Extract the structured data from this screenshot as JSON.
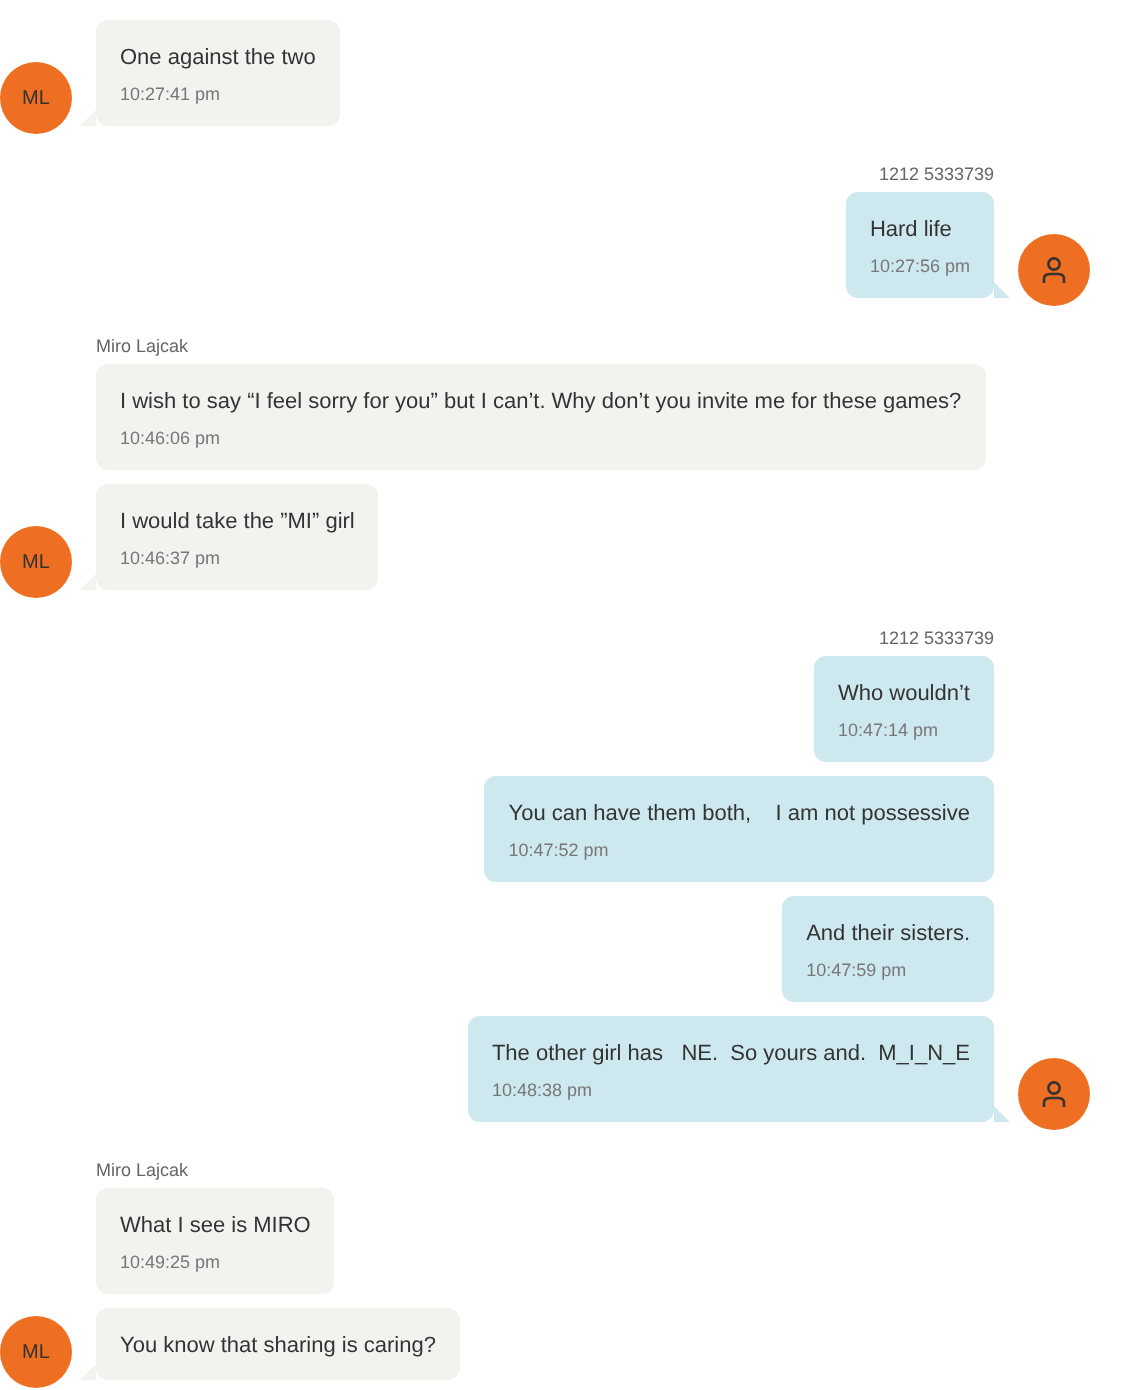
{
  "groups": [
    {
      "outgoing": false,
      "avatar": {
        "kind": "initials",
        "text": "ML"
      },
      "messages": [
        {
          "text": "One against the two",
          "time": "10:27:41 pm"
        }
      ]
    },
    {
      "outgoing": true,
      "sender": "1212 5333739",
      "avatar": {
        "kind": "person"
      },
      "messages": [
        {
          "text": "Hard life",
          "time": "10:27:56 pm"
        }
      ]
    },
    {
      "outgoing": false,
      "sender": "Miro Lajcak",
      "avatar": {
        "kind": "initials",
        "text": "ML"
      },
      "messages": [
        {
          "text": "I wish to say “I feel sorry for you” but I can’t. Why don’t you invite me for these games?",
          "time": "10:46:06 pm"
        },
        {
          "text": "I would take the ”MI” girl",
          "time": "10:46:37 pm"
        }
      ]
    },
    {
      "outgoing": true,
      "sender": "1212 5333739",
      "avatar": {
        "kind": "person"
      },
      "messages": [
        {
          "text": "Who wouldn’t",
          "time": "10:47:14 pm"
        },
        {
          "text": "You can have them both,    I am not possessive",
          "time": "10:47:52 pm"
        },
        {
          "text": "And their sisters.",
          "time": "10:47:59 pm"
        },
        {
          "text": "The other girl has   NE.  So yours and.  M_I_N_E",
          "time": "10:48:38 pm"
        }
      ]
    },
    {
      "outgoing": false,
      "sender": "Miro Lajcak",
      "avatar": {
        "kind": "initials",
        "text": "ML"
      },
      "messages": [
        {
          "text": "What I see is MIRO",
          "time": "10:49:25 pm"
        },
        {
          "text": "You know that sharing is caring?"
        }
      ]
    }
  ]
}
